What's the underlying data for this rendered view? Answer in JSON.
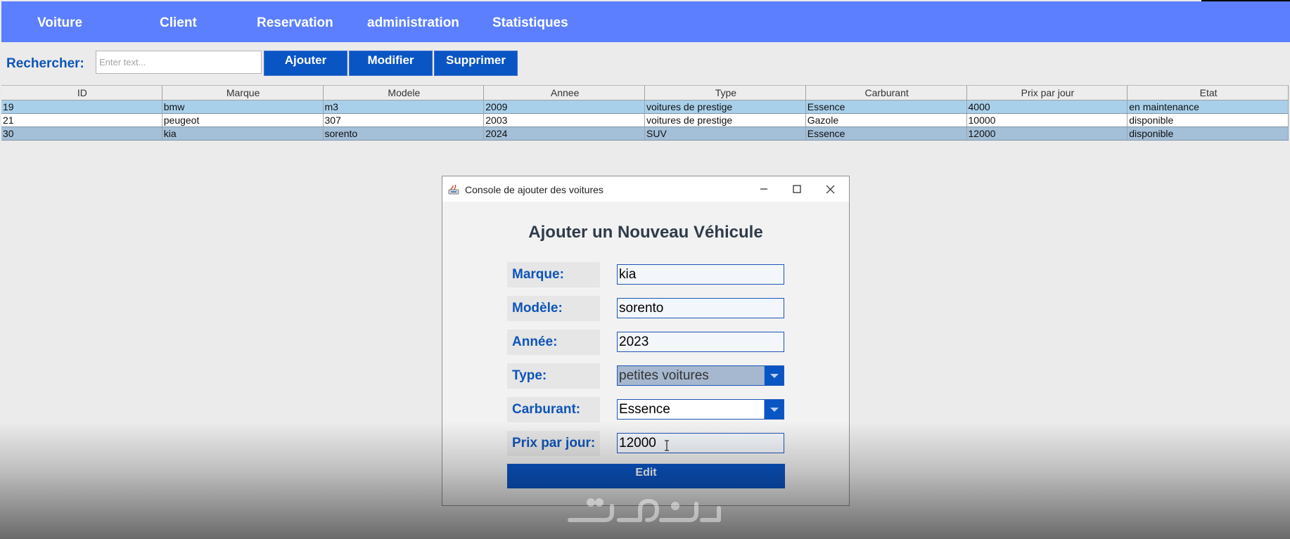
{
  "menu": {
    "items": [
      "Voiture",
      "Client",
      "Reservation",
      "administration",
      "Statistiques"
    ]
  },
  "toolbar": {
    "search_label": "Rechercher:",
    "search_placeholder": "Enter text...",
    "search_value": "",
    "add_label": "Ajouter",
    "modify_label": "Modifier",
    "delete_label": "Supprimer"
  },
  "table": {
    "columns": [
      "ID",
      "Marque",
      "Modele",
      "Annee",
      "Type",
      "Carburant",
      "Prix par jour",
      "Etat"
    ],
    "rows": [
      [
        "19",
        "bmw",
        "m3",
        "2009",
        "voitures de prestige",
        "Essence",
        "4000",
        "en maintenance"
      ],
      [
        "21",
        "peugeot",
        "307",
        "2003",
        "voitures de prestige",
        "Gazole",
        "10000",
        "disponible"
      ],
      [
        "30",
        "kia",
        "sorento",
        "2024",
        "SUV",
        "Essence",
        "12000",
        " disponible"
      ]
    ]
  },
  "dialog": {
    "window_title": "Console de ajouter des voitures",
    "heading": "Ajouter un Nouveau Véhicule",
    "marque_label": "Marque:",
    "marque_value": "kia",
    "modele_label": "Modèle:",
    "modele_value": "sorento",
    "annee_label": "Année:",
    "annee_value": "2023",
    "type_label": "Type:",
    "type_value": "petites voitures",
    "carburant_label": "Carburant:",
    "carburant_value": "Essence",
    "prix_label": "Prix par jour:",
    "prix_value": "12000",
    "edit_label": "Edit"
  },
  "colors": {
    "menubar": "#5b7fff",
    "button": "#0a55c4",
    "label_text": "#0e54b8"
  }
}
